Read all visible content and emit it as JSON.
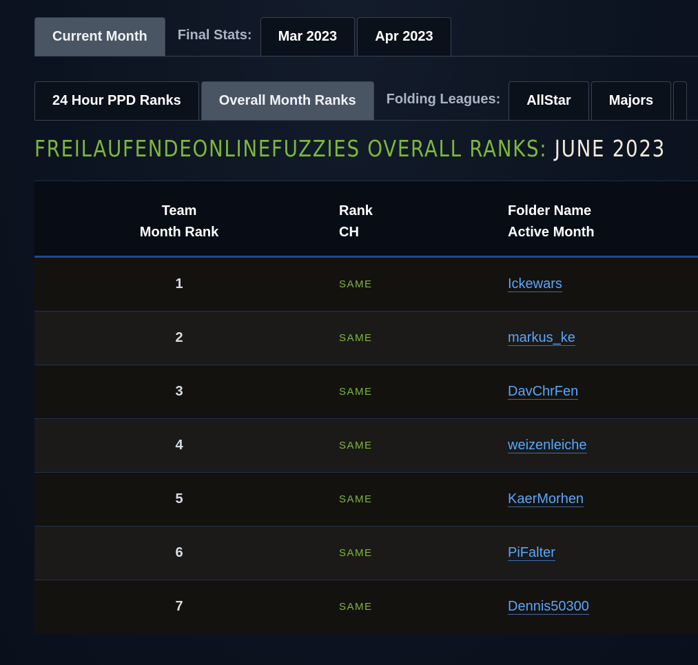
{
  "month_tabs": {
    "current": "Current Month",
    "final_stats_label": "Final Stats:",
    "items": [
      "Mar 2023",
      "Apr 2023"
    ]
  },
  "rank_tabs": {
    "ppd": "24 Hour PPD Ranks",
    "overall": "Overall Month Ranks",
    "leagues_label": "Folding Leagues:",
    "leagues": [
      "AllStar",
      "Majors"
    ]
  },
  "title": {
    "team_part": "FreilaufendeOnlineFuzzies Overall Ranks:",
    "month_part": "June 2023"
  },
  "table": {
    "headers": [
      [
        "Team",
        "Month Rank"
      ],
      [
        "Rank",
        "CH"
      ],
      [
        "Folder Name",
        "Active Month"
      ]
    ],
    "rows": [
      {
        "rank": "1",
        "change": "SAME",
        "name": "Ickewars"
      },
      {
        "rank": "2",
        "change": "SAME",
        "name": "markus_ke"
      },
      {
        "rank": "3",
        "change": "SAME",
        "name": "DavChrFen"
      },
      {
        "rank": "4",
        "change": "SAME",
        "name": "weizenleiche"
      },
      {
        "rank": "5",
        "change": "SAME",
        "name": "KaerMorhen"
      },
      {
        "rank": "6",
        "change": "SAME",
        "name": "PiFalter"
      },
      {
        "rank": "7",
        "change": "SAME",
        "name": "Dennis50300"
      }
    ]
  },
  "colors": {
    "accent_green": "#7db83a",
    "link_blue": "#58a6ff",
    "active_tab": "#4a5563"
  }
}
